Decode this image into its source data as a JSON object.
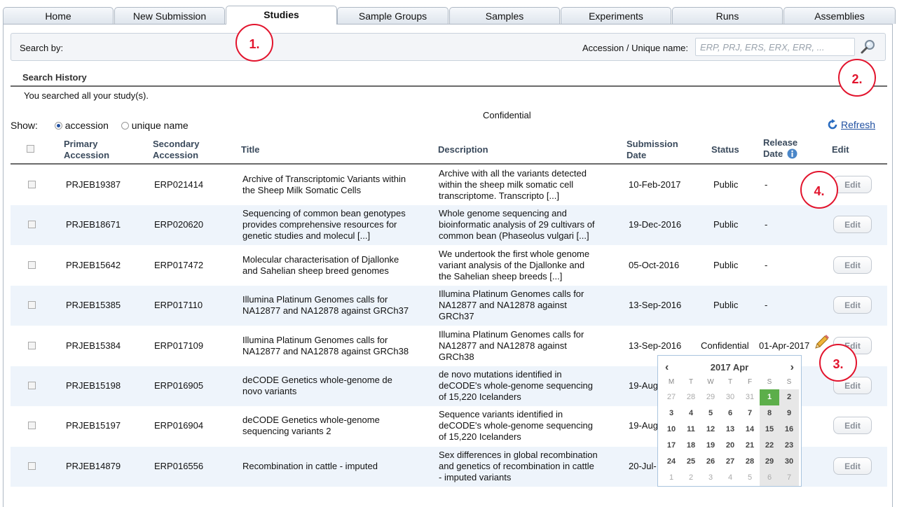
{
  "tabs": [
    "Home",
    "New Submission",
    "Studies",
    "Sample Groups",
    "Samples",
    "Experiments",
    "Runs",
    "Assemblies"
  ],
  "active_tab": "Studies",
  "search": {
    "label": "Search by:",
    "accession_label": "Accession / Unique name:",
    "placeholder": "ERP, PRJ, ERS, ERX, ERR, ..."
  },
  "history": {
    "title": "Search History",
    "text": "You searched all your study(s)."
  },
  "confidential_label": "Confidential",
  "show": {
    "label": "Show:",
    "options": [
      "accession",
      "unique name"
    ],
    "selected": "accession"
  },
  "refresh_label": "Refresh",
  "columns": {
    "primary": [
      "Primary",
      "Accession"
    ],
    "secondary": [
      "Secondary",
      "Accession"
    ],
    "title": "Title",
    "description": "Description",
    "submission": [
      "Submission",
      "Date"
    ],
    "status": "Status",
    "release": [
      "Release",
      "Date"
    ],
    "edit": "Edit"
  },
  "rows": [
    {
      "primary": "PRJEB19387",
      "secondary": "ERP021414",
      "title": [
        "Archive of Transcriptomic Variants within",
        "the Sheep Milk Somatic Cells"
      ],
      "description": [
        "Archive with all the variants detected",
        "within the sheep milk somatic cell",
        "transcriptome. Transcripto [...]"
      ],
      "submission": "10-Feb-2017",
      "status": "Public",
      "release": "-",
      "edit": "Edit"
    },
    {
      "primary": "PRJEB18671",
      "secondary": "ERP020620",
      "title": [
        "Sequencing of common bean genotypes",
        "provides comprehensive resources for",
        "genetic studies and molecul [...]"
      ],
      "description": [
        "Whole genome sequencing and",
        "bioinformatic analysis of 29 cultivars of",
        "common bean (Phaseolus vulgari [...]"
      ],
      "submission": "19-Dec-2016",
      "status": "Public",
      "release": "-",
      "edit": "Edit"
    },
    {
      "primary": "PRJEB15642",
      "secondary": "ERP017472",
      "title": [
        "Molecular characterisation of Djallonke",
        "and Sahelian sheep breed genomes"
      ],
      "description": [
        "We undertook the first whole genome",
        "variant analysis of the Djallonke and",
        "the Sahelian sheep breeds [...]"
      ],
      "submission": "05-Oct-2016",
      "status": "Public",
      "release": "-",
      "edit": "Edit"
    },
    {
      "primary": "PRJEB15385",
      "secondary": "ERP017110",
      "title": [
        "Illumina Platinum Genomes calls for",
        "NA12877 and NA12878 against GRCh37"
      ],
      "description": [
        "Illumina Platinum Genomes calls for",
        "NA12877 and NA12878 against",
        "GRCh37"
      ],
      "submission": "13-Sep-2016",
      "status": "Public",
      "release": "-",
      "edit": "Edit"
    },
    {
      "primary": "PRJEB15384",
      "secondary": "ERP017109",
      "title": [
        "Illumina Platinum Genomes calls for",
        "NA12877 and NA12878 against GRCh38"
      ],
      "description": [
        "Illumina Platinum Genomes calls for",
        "NA12877 and NA12878 against",
        "GRCh38"
      ],
      "submission": "13-Sep-2016",
      "status": "Confidential",
      "release": "01-Apr-2017",
      "edit": "Edit"
    },
    {
      "primary": "PRJEB15198",
      "secondary": "ERP016905",
      "title": [
        "deCODE Genetics whole-genome de",
        "novo variants"
      ],
      "description": [
        "de novo mutations identified in",
        "deCODE's whole-genome sequencing",
        "of 15,220 Icelanders"
      ],
      "submission": "19-Aug",
      "status": "",
      "release": "",
      "edit": "Edit"
    },
    {
      "primary": "PRJEB15197",
      "secondary": "ERP016904",
      "title": [
        "deCODE Genetics whole-genome",
        "sequencing variants 2"
      ],
      "description": [
        "Sequence variants identified in",
        "deCODE's whole-genome sequencing",
        "of 15,220 Icelanders"
      ],
      "submission": "19-Aug",
      "status": "",
      "release": "",
      "edit": "Edit"
    },
    {
      "primary": "PRJEB14879",
      "secondary": "ERP016556",
      "title": [
        "Recombination in cattle - imputed"
      ],
      "description": [
        "Sex differences in global recombination",
        "and genetics of recombination in cattle",
        "- imputed variants"
      ],
      "submission": "20-Jul-",
      "status": "",
      "release": "",
      "edit": "Edit"
    }
  ],
  "calendar": {
    "title": "2017 Apr",
    "prev": "‹",
    "next": "›",
    "dow": [
      "M",
      "T",
      "W",
      "T",
      "F",
      "S",
      "S"
    ],
    "weeks": [
      [
        "27",
        "28",
        "29",
        "30",
        "31",
        "1",
        "2"
      ],
      [
        "3",
        "4",
        "5",
        "6",
        "7",
        "8",
        "9"
      ],
      [
        "10",
        "11",
        "12",
        "13",
        "14",
        "15",
        "16"
      ],
      [
        "17",
        "18",
        "19",
        "20",
        "21",
        "22",
        "23"
      ],
      [
        "24",
        "25",
        "26",
        "27",
        "28",
        "29",
        "30"
      ],
      [
        "1",
        "2",
        "3",
        "4",
        "5",
        "6",
        "7"
      ]
    ],
    "selected": "1"
  },
  "annotations": [
    "1.",
    "2.",
    "3.",
    "4."
  ],
  "colors": {
    "accent": "#1f4fa0",
    "annotation": "#e2142d",
    "selected_day": "#5cae4a",
    "row_alt": "#eef4fb"
  },
  "icons": {
    "search": "magnifier-icon",
    "refresh": "refresh-icon",
    "info": "info-icon",
    "pencil": "pencil-icon"
  }
}
